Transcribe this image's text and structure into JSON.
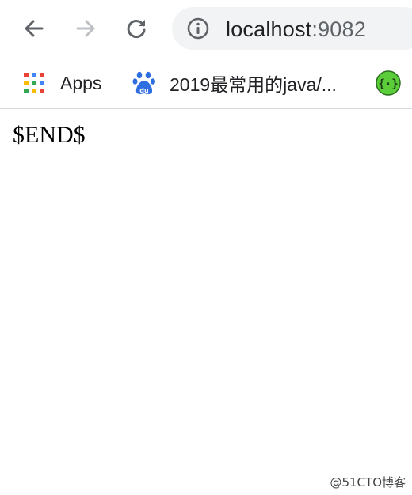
{
  "browser": {
    "url_host": "localhost",
    "url_port": ":9082",
    "icons": {
      "back": "back-arrow-icon",
      "forward": "forward-arrow-icon",
      "reload": "reload-icon",
      "info": "info-icon"
    }
  },
  "bookmarks": [
    {
      "label": "Apps",
      "icon": "apps-grid-icon"
    },
    {
      "label": "2019最常用的java/...",
      "icon": "baidu-paw-icon"
    },
    {
      "label": "",
      "icon": "extension-braces-icon"
    }
  ],
  "page": {
    "text": "$END$"
  },
  "watermark": "@51CTO博客",
  "colors": {
    "icon_gray": "#5f6368",
    "disabled_gray": "#bdc1c6",
    "omnibox_bg": "#f1f3f4",
    "baidu_blue": "#2f6ee0",
    "extension_green": "#5ccd3a"
  }
}
